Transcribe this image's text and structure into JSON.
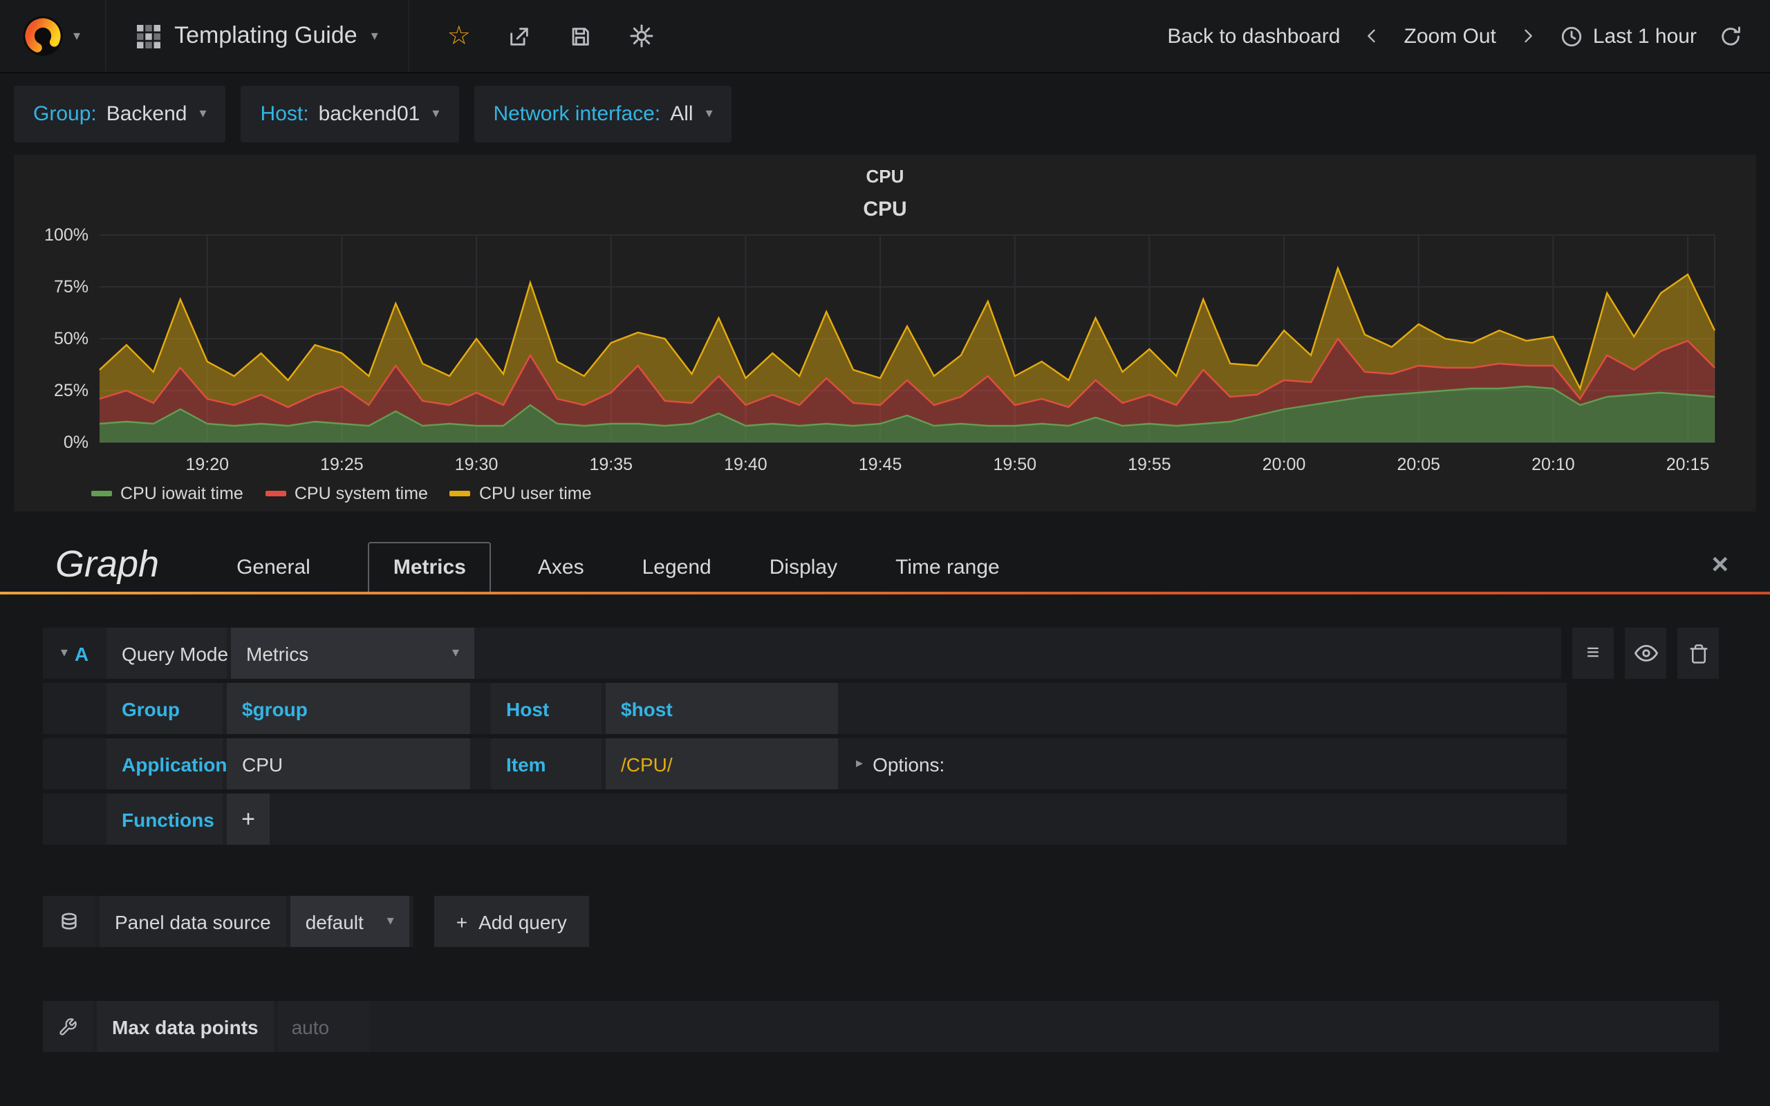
{
  "icons": {
    "caret_down": "▾",
    "caret_right": "▸",
    "menu": "≡",
    "close": "×",
    "star": "☆",
    "plus": "+"
  },
  "navbar": {
    "title": "Templating Guide",
    "back_to_dashboard": "Back to dashboard",
    "zoom_out": "Zoom Out",
    "time_range": "Last 1 hour"
  },
  "template_vars": {
    "group": {
      "label": "Group:",
      "value": "Backend"
    },
    "host": {
      "label": "Host:",
      "value": "backend01"
    },
    "network_interface": {
      "label": "Network interface:",
      "value": "All"
    }
  },
  "panel": {
    "header_title": "CPU",
    "chart_title": "CPU"
  },
  "chart_data": {
    "type": "area",
    "stacked": true,
    "title": "CPU",
    "unit": "percent",
    "ylim": [
      0,
      100
    ],
    "grid": true,
    "legend_position": "bottom-left",
    "yticks": [
      {
        "label": "0%",
        "value": 0
      },
      {
        "label": "25%",
        "value": 25
      },
      {
        "label": "50%",
        "value": 50
      },
      {
        "label": "75%",
        "value": 75
      },
      {
        "label": "100%",
        "value": 100
      }
    ],
    "x_start": "19:16",
    "x_end": "20:16",
    "step_minutes": 1,
    "xticks": [
      {
        "label": "19:20",
        "min": 4
      },
      {
        "label": "19:25",
        "min": 9
      },
      {
        "label": "19:30",
        "min": 14
      },
      {
        "label": "19:35",
        "min": 19
      },
      {
        "label": "19:40",
        "min": 24
      },
      {
        "label": "19:45",
        "min": 29
      },
      {
        "label": "19:50",
        "min": 34
      },
      {
        "label": "19:55",
        "min": 39
      },
      {
        "label": "20:00",
        "min": 44
      },
      {
        "label": "20:05",
        "min": 49
      },
      {
        "label": "20:10",
        "min": 54
      },
      {
        "label": "20:15",
        "min": 59
      }
    ],
    "series": [
      {
        "name": "CPU iowait time",
        "color": "#629e51",
        "fill_opacity": 0.6,
        "values": [
          9,
          10,
          9,
          16,
          9,
          8,
          9,
          8,
          10,
          9,
          8,
          15,
          8,
          9,
          8,
          8,
          18,
          9,
          8,
          9,
          9,
          8,
          9,
          14,
          8,
          9,
          8,
          9,
          8,
          9,
          13,
          8,
          9,
          8,
          8,
          9,
          8,
          12,
          8,
          9,
          8,
          9,
          10,
          13,
          16,
          18,
          20,
          22,
          23,
          24,
          25,
          26,
          26,
          27,
          26,
          18,
          22,
          23,
          24,
          23,
          22
        ]
      },
      {
        "name": "CPU system time",
        "color": "#e24d42",
        "fill_opacity": 0.45,
        "values": [
          12,
          15,
          10,
          20,
          12,
          10,
          14,
          9,
          13,
          18,
          10,
          22,
          12,
          9,
          16,
          10,
          24,
          12,
          10,
          15,
          28,
          12,
          10,
          18,
          10,
          14,
          10,
          22,
          11,
          9,
          17,
          10,
          13,
          24,
          10,
          12,
          9,
          18,
          11,
          14,
          10,
          26,
          12,
          10,
          14,
          11,
          30,
          12,
          10,
          13,
          11,
          10,
          12,
          10,
          11,
          3,
          20,
          12,
          20,
          26,
          14
        ]
      },
      {
        "name": "CPU user time",
        "color": "#e5ac0e",
        "fill_opacity": 0.45,
        "values": [
          14,
          22,
          15,
          33,
          18,
          14,
          20,
          13,
          24,
          16,
          14,
          30,
          18,
          14,
          26,
          15,
          35,
          18,
          14,
          24,
          16,
          30,
          14,
          28,
          13,
          20,
          14,
          32,
          16,
          13,
          26,
          14,
          20,
          36,
          14,
          18,
          13,
          30,
          15,
          22,
          14,
          34,
          16,
          14,
          24,
          13,
          34,
          18,
          13,
          20,
          14,
          12,
          16,
          12,
          14,
          5,
          30,
          16,
          28,
          32,
          18
        ]
      }
    ]
  },
  "editor": {
    "panel_type_title": "Graph",
    "tabs": [
      {
        "label": "General"
      },
      {
        "label": "Metrics"
      },
      {
        "label": "Axes"
      },
      {
        "label": "Legend"
      },
      {
        "label": "Display"
      },
      {
        "label": "Time range"
      }
    ],
    "active_tab": "Metrics",
    "query": {
      "ref_id": "A",
      "query_mode_label": "Query Mode",
      "query_mode_value": "Metrics",
      "rows": {
        "group_label": "Group",
        "group_value": "$group",
        "host_label": "Host",
        "host_value": "$host",
        "application_label": "Application",
        "application_value": "CPU",
        "item_label": "Item",
        "item_value": "/CPU/",
        "options_label": "Options:",
        "functions_label": "Functions",
        "add_function_label": "+"
      }
    },
    "datasource": {
      "label": "Panel data source",
      "value": "default",
      "add_query_label": "Add query"
    },
    "footer": {
      "max_data_points_label": "Max data points",
      "max_data_points_placeholder": "auto"
    }
  }
}
